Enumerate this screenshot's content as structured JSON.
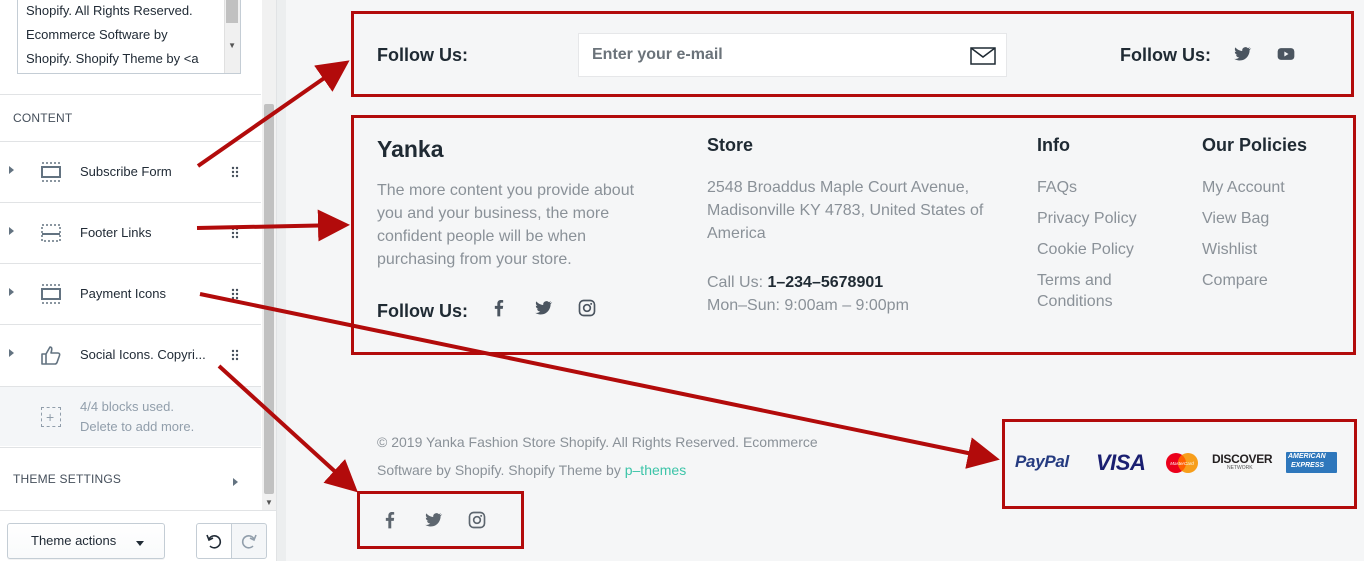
{
  "sidebar": {
    "textarea_lines": [
      "Shopify. All Rights Reserved.",
      "Ecommerce Software by",
      "Shopify. Shopify Theme by <a"
    ],
    "content_label": "CONTENT",
    "blocks": [
      {
        "label": "Subscribe Form",
        "icon": "layout-section-icon"
      },
      {
        "label": "Footer Links",
        "icon": "layout-section-icon"
      },
      {
        "label": "Payment Icons",
        "icon": "layout-section-icon"
      },
      {
        "label": "Social Icons. Copyri...",
        "icon": "thumbs-up-icon"
      }
    ],
    "blocks_used": "4/4 blocks used.",
    "blocks_hint": "Delete to add more.",
    "theme_settings_label": "THEME SETTINGS",
    "theme_actions_label": "Theme actions"
  },
  "preview": {
    "subscribe": {
      "follow_label": "Follow Us:",
      "email_placeholder": "Enter your e-mail",
      "follow_label_right": "Follow Us:"
    },
    "brand": {
      "title": "Yanka",
      "description_lines": [
        "The more content you provide about",
        "you and your business, the more",
        "confident people will be when",
        "purchasing from your store."
      ],
      "follow_label": "Follow Us:"
    },
    "store": {
      "title": "Store",
      "address_lines": [
        "2548 Broaddus Maple Court Avenue,",
        "Madisonville KY 4783, United States of",
        "America"
      ],
      "call_label": "Call Us: ",
      "phone": "1–234–5678901",
      "hours": "Mon–Sun: 9:00am – 9:00pm"
    },
    "info": {
      "title": "Info",
      "links": [
        "FAQs",
        "Privacy Policy",
        "Cookie Policy",
        "Terms and",
        "Conditions"
      ]
    },
    "policies": {
      "title": "Our Policies",
      "links": [
        "My Account",
        "View Bag",
        "Wishlist",
        "Compare"
      ]
    },
    "copyright_line1": "© 2019 Yanka Fashion Store Shopify. All Rights Reserved. Ecommerce",
    "copyright_line2_prefix": "Software by Shopify. Shopify Theme by ",
    "copyright_link": "p–themes",
    "payment_labels": {
      "paypal": "PayPal",
      "visa": "VISA",
      "mastercard": "MasterCard",
      "discover": "DISCOVER",
      "discover_sub": "NETWORK",
      "amex_line1": "AMERICAN",
      "amex_line2": "EXPRESS"
    }
  },
  "colors": {
    "annotation_red": "#b20b0b",
    "link_teal": "#3cc4a8",
    "heading": "#1f2a33",
    "muted": "#8a9198"
  }
}
